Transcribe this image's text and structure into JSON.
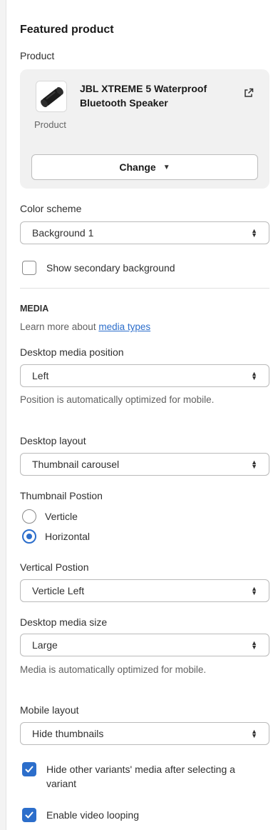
{
  "section": {
    "title": "Featured product"
  },
  "product": {
    "label": "Product",
    "name": "JBL XTREME 5 Waterproof Bluetooth Speaker",
    "sub_label": "Product",
    "change_label": "Change"
  },
  "color_scheme": {
    "label": "Color scheme",
    "value": "Background 1"
  },
  "secondary_background": {
    "label": "Show secondary background",
    "checked": false
  },
  "media": {
    "heading": "MEDIA",
    "learn_prefix": "Learn more about ",
    "learn_link": "media types"
  },
  "desktop_media_position": {
    "label": "Desktop media position",
    "value": "Left",
    "help": "Position is automatically optimized for mobile."
  },
  "desktop_layout": {
    "label": "Desktop layout",
    "value": "Thumbnail carousel"
  },
  "thumbnail_position": {
    "label": "Thumbnail Postion",
    "options": [
      {
        "label": "Verticle",
        "checked": false
      },
      {
        "label": "Horizontal",
        "checked": true
      }
    ]
  },
  "vertical_position": {
    "label": "Vertical Postion",
    "value": "Verticle Left"
  },
  "desktop_media_size": {
    "label": "Desktop media size",
    "value": "Large",
    "help": "Media is automatically optimized for mobile."
  },
  "mobile_layout": {
    "label": "Mobile layout",
    "value": "Hide thumbnails"
  },
  "hide_variants_media": {
    "label": "Hide other variants' media after selecting a variant",
    "checked": true
  },
  "video_looping": {
    "label": "Enable video looping",
    "checked": true
  },
  "colors": {
    "accent": "#2c6ecb",
    "card_bg": "#f1f1f1"
  }
}
